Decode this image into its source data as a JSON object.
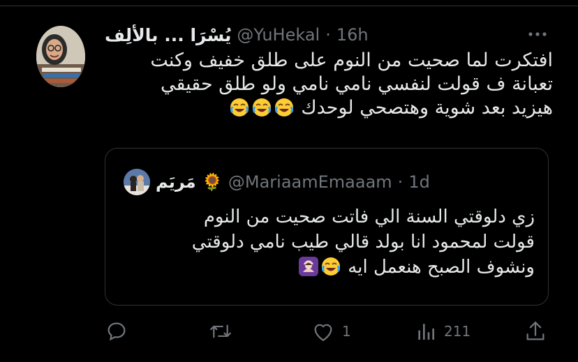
{
  "tweet": {
    "display_name": "يُسْرَا ... بالألِف",
    "handle": "@YuHekal",
    "separator": "·",
    "time": "16h",
    "text_lines": [
      "افتكرت لما صحيت من النوم على طلق خفيف وكنت",
      "تعبانة ف قولت لنفسي نامي نامي ولو طلق حقيقي",
      "هيزيد بعد شوية وهتصحي لوحدك"
    ],
    "text_emoji": "face-with-tears-of-joy ×3"
  },
  "quote": {
    "display_name": "مَريَم 🌻",
    "handle": "@MariaamEmaaam",
    "separator": "·",
    "time": "1d",
    "text_lines": [
      "زي دلوقتي السنة الي فاتت صحيت من النوم",
      "قولت لمحمود انا بولد قالي طيب نامي دلوقتي",
      "ونشوف الصبح هنعمل ايه"
    ],
    "text_emoji": "face-with-tears-of-joy, person-gesturing-ok"
  },
  "actions": {
    "reply_count": "",
    "retweet_count": "",
    "like_count": "1",
    "views_count": "211"
  },
  "colors": {
    "background": "#000000",
    "text": "#e7e9ea",
    "muted": "#71767b",
    "border": "#2f3336"
  }
}
